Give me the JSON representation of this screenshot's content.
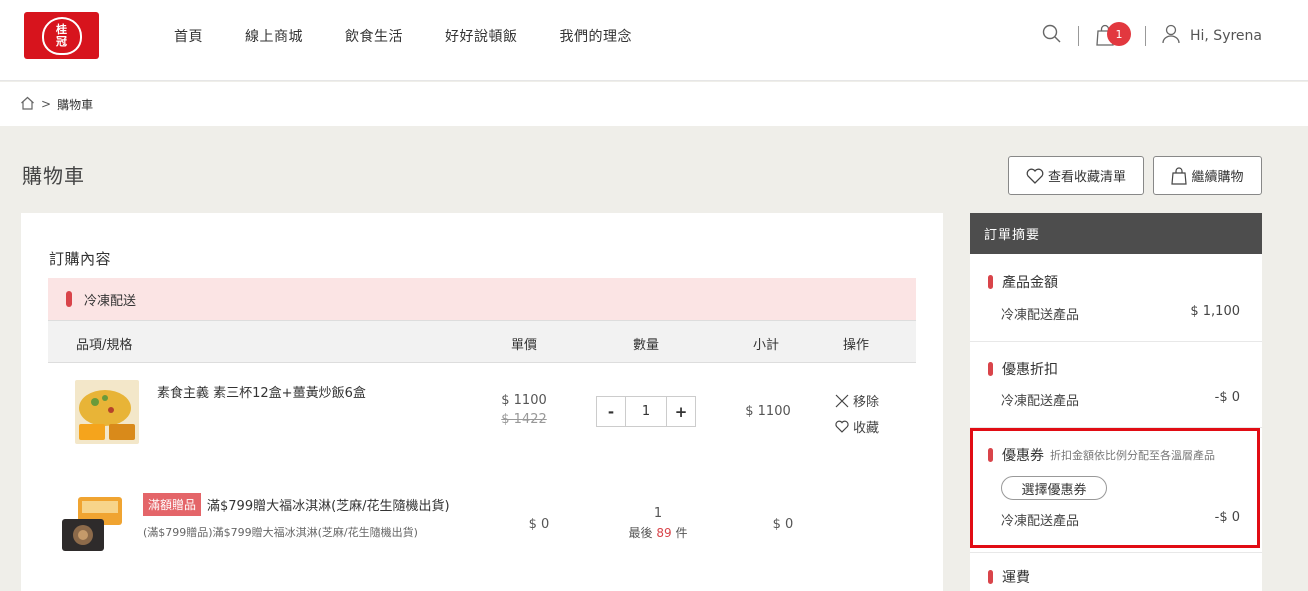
{
  "header": {
    "logo_text_1": "桂",
    "logo_text_2": "冠",
    "nav": [
      "首頁",
      "線上商城",
      "飲食生活",
      "好好說頓飯",
      "我們的理念"
    ],
    "cart_count": "1",
    "greeting": "Hi, Syrena"
  },
  "breadcrumb": {
    "sep": ">",
    "current": "購物車"
  },
  "page": {
    "title": "購物車",
    "wishlist_btn": "查看收藏清單",
    "continue_btn": "繼續購物"
  },
  "order": {
    "section_title": "訂購內容",
    "shipping_label": "冷凍配送",
    "columns": {
      "item": "品項/規格",
      "price": "單價",
      "qty": "數量",
      "subtotal": "小計",
      "action": "操作"
    },
    "items": [
      {
        "name": "素食主義 素三杯12盒+薑黃炒飯6盒",
        "price": "$ 1100",
        "original_price": "$ 1422",
        "qty": "1",
        "qty_minus": "-",
        "qty_plus": "+",
        "subtotal": "$ 1100",
        "remove": "移除",
        "favorite": "收藏"
      },
      {
        "tag": "滿額贈品",
        "name": "滿$799贈大福冰淇淋(芝麻/花生隨機出貨)",
        "sub": "(滿$799贈品)滿$799贈大福冰淇淋(芝麻/花生隨機出貨)",
        "price": "$ 0",
        "qty": "1",
        "stock_prefix": "最後",
        "stock_num": "89",
        "stock_suffix": "件",
        "subtotal": "$ 0"
      }
    ]
  },
  "summary": {
    "title": "訂單摘要",
    "product_amount": {
      "title": "產品金額",
      "label": "冷凍配送產品",
      "value": "$ 1,100"
    },
    "discount": {
      "title": "優惠折扣",
      "label": "冷凍配送產品",
      "value": "-$ 0"
    },
    "coupon": {
      "title": "優惠券",
      "note": "折扣金額依比例分配至各溫層產品",
      "button": "選擇優惠券",
      "label": "冷凍配送產品",
      "value": "-$ 0"
    },
    "shipping": {
      "title": "運費"
    }
  },
  "colors": {
    "brand_red": "#d7141d",
    "accent_red": "#d9444a",
    "highlight": "#e10c14"
  }
}
